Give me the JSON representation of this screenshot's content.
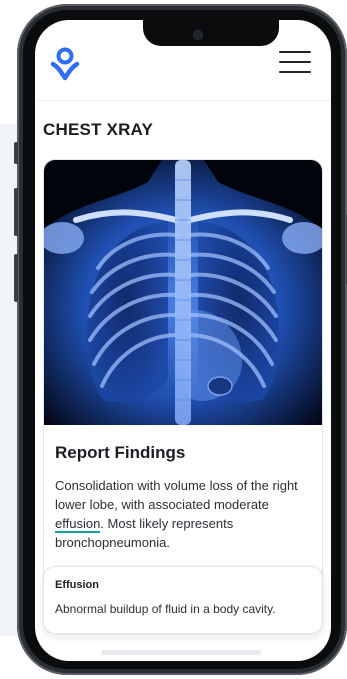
{
  "page": {
    "title": "CHEST XRAY"
  },
  "header": {
    "logo_icon": "person-location-pin-icon",
    "menu_icon": "hamburger-menu-icon",
    "accent": "#2f6df6"
  },
  "image": {
    "description_icon": "chest-xray-image"
  },
  "report": {
    "heading": "Report Findings",
    "text_before": "Consolidation with volume loss of the right lower lobe, with associated moderate ",
    "highlight_term": "effusion",
    "text_after": ". Most likely represents bronchopneumonia.",
    "highlight_color": "#16a6a0"
  },
  "definition": {
    "term": "Effusion",
    "text": "Abnormal buildup of fluid in a body cavity."
  }
}
